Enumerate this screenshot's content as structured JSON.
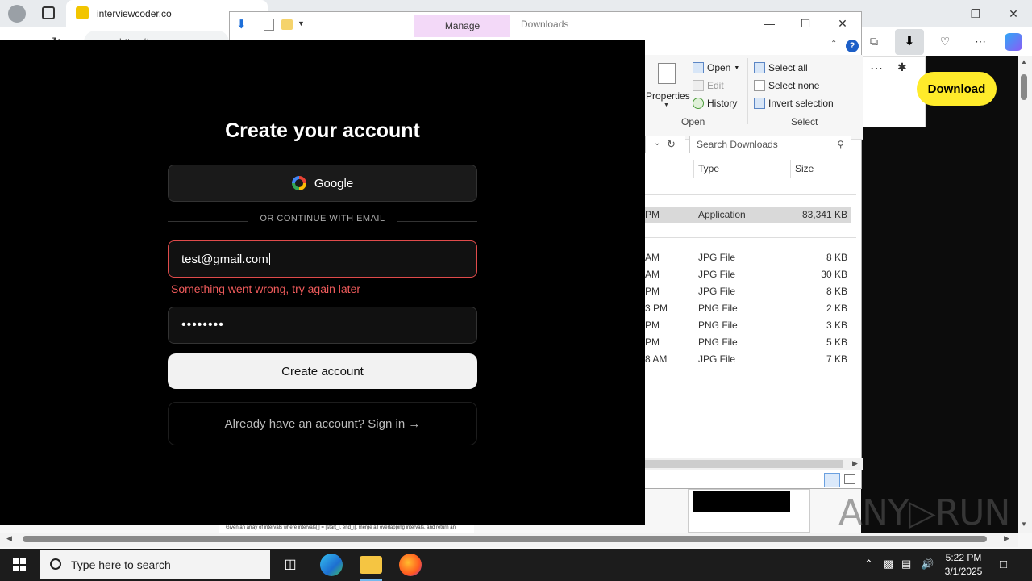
{
  "browser": {
    "tab_title": "interviewcoder.co",
    "url_fragment": "https://",
    "download_button": "Download"
  },
  "explorer": {
    "manage_tab": "Manage",
    "title": "Downloads",
    "ribbon": {
      "properties": "Properties",
      "open": "Open",
      "edit": "Edit",
      "history": "History",
      "open_group": "Open",
      "select_all": "Select all",
      "select_none": "Select none",
      "invert_selection": "Invert selection",
      "select_group": "Select"
    },
    "search_placeholder": "Search Downloads",
    "columns": {
      "type": "Type",
      "size": "Size"
    },
    "rows": [
      {
        "date": "PM",
        "type": "Application",
        "size": "83,341 KB",
        "selected": true
      },
      {
        "date": "AM",
        "type": "JPG File",
        "size": "8 KB"
      },
      {
        "date": "AM",
        "type": "JPG File",
        "size": "30 KB"
      },
      {
        "date": "PM",
        "type": "JPG File",
        "size": "8 KB"
      },
      {
        "date": "3 PM",
        "type": "PNG File",
        "size": "2 KB"
      },
      {
        "date": "PM",
        "type": "PNG File",
        "size": "3 KB"
      },
      {
        "date": "PM",
        "type": "PNG File",
        "size": "5 KB"
      },
      {
        "date": "8 AM",
        "type": "JPG File",
        "size": "7 KB"
      }
    ]
  },
  "signup": {
    "title": "Create your account",
    "google_label": "Google",
    "divider": "OR CONTINUE WITH EMAIL",
    "email_value": "test@gmail.com",
    "error": "Something went wrong, try again later",
    "password_masked": "••••••••",
    "create_button": "Create account",
    "signin_link": "Already have an account? Sign in →"
  },
  "page_strip_text": "Given an array of intervals where intervals[i] = [start_i, end_i], merge all overlapping intervals, and return an",
  "watermark": "ANY▷RUN",
  "taskbar": {
    "search_placeholder": "Type here to search",
    "time": "5:22 PM",
    "date": "3/1/2025"
  },
  "colors": {
    "error": "#ef5b5b",
    "manage_tab": "#f3d9f8",
    "download_btn": "#ffeb2a"
  }
}
